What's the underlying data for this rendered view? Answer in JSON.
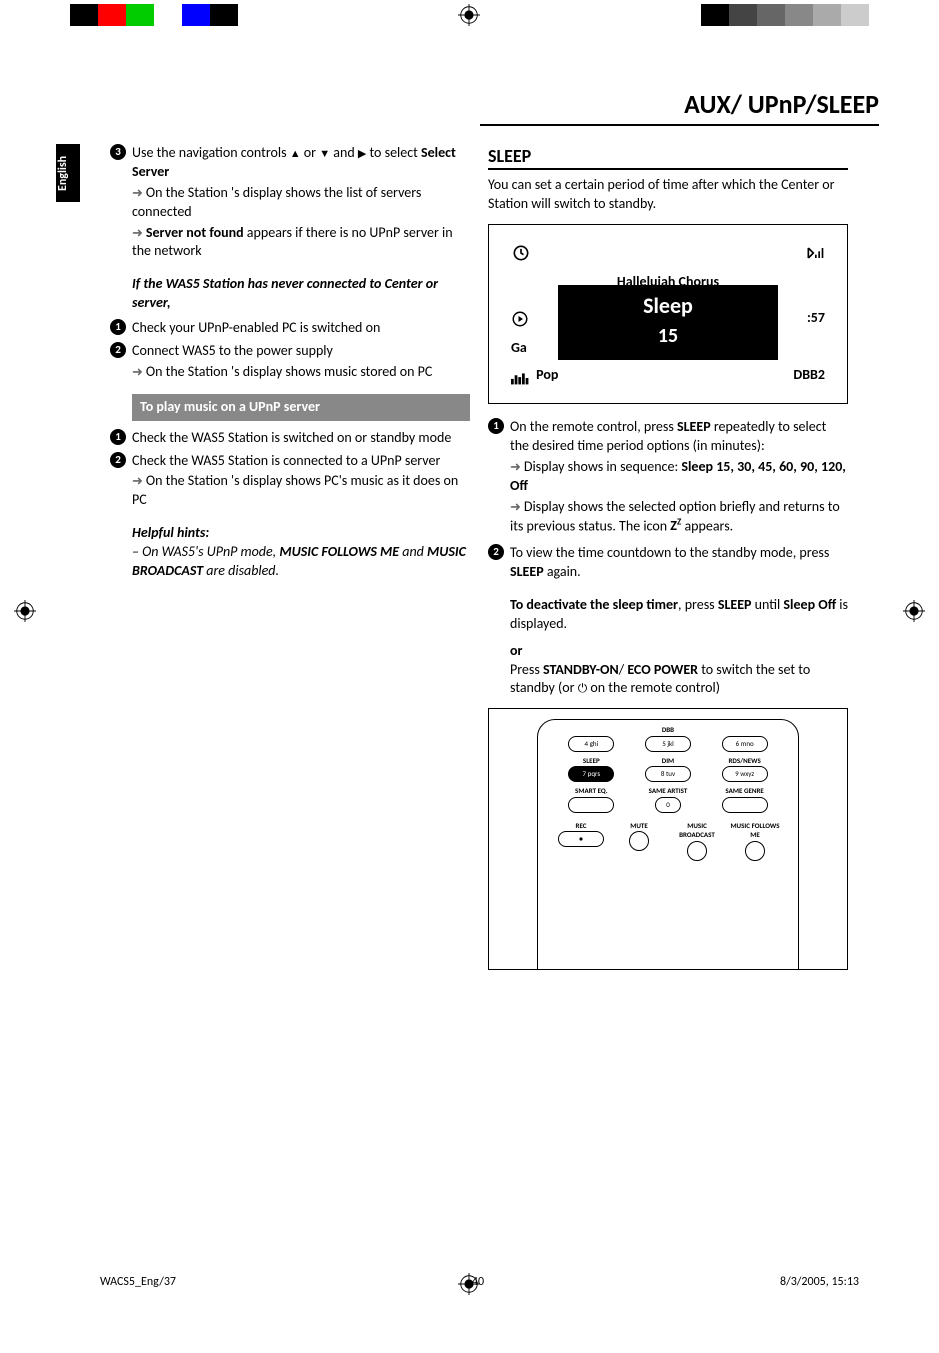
{
  "lang_tab": "English",
  "header": "AUX/ UPnP/SLEEP",
  "left": {
    "step3_a": "Use the navigation controls ",
    "step3_b": " or ",
    "step3_c": " and ",
    "step3_d": " to select ",
    "step3_bold": "Select Server",
    "step3_sub1": "On the Station 's display shows the list of servers connected",
    "step3_sub2_bold": "Server not found",
    "step3_sub2_rest": " appears if there is no UPnP server in the network",
    "if_heading": "If the WAS5 Station has never connected to Center or server,",
    "if_step1": "Check your UPnP-enabled PC is switched on",
    "if_step2": "Connect  WAS5 to the power supply",
    "if_step2_sub": "On the Station 's display shows music stored on PC",
    "play_box": "To play music on a UPnP server",
    "play_step1": "Check the WAS5 Station is switched on or standby mode",
    "play_step2": "Check the WAS5 Station is connected to a UPnP server",
    "play_step2_sub": "On the Station 's display shows PC's music as it does on PC",
    "hints_label": "Helpful hints:",
    "hints_body_a": "– On WAS5's UPnP mode, ",
    "hints_body_b": "MUSIC FOLLOWS ME",
    "hints_body_c": " and ",
    "hints_body_d": "MUSIC BROADCAST",
    "hints_body_e": " are disabled."
  },
  "right": {
    "sleep_h": "SLEEP",
    "sleep_intro": "You can set a certain period of time after which the Center or Station will switch to standby.",
    "lcd": {
      "song": "Halleluiah Chorus",
      "overlay_title": "Sleep",
      "overlay_value": "15",
      "time_suffix": ":57",
      "artist_initial": "Ga",
      "genre": "Pop",
      "dbb": "DBB2"
    },
    "s1_a": "On the remote control, press ",
    "s1_b": "SLEEP",
    "s1_c": " repeatedly to select the desired time period options (in minutes):",
    "s1_seq_a": "Display shows in sequence: ",
    "s1_seq_b": "Sleep 15,  30, 45, 60, 90, 120, Off",
    "s1_sel_a": "Display shows the selected option briefly and returns to its previous status. The icon ",
    "s1_sel_b": "Z",
    "s1_sel_c": " appears.",
    "s2_a": "To view the time countdown to the standby mode, press ",
    "s2_b": "SLEEP",
    "s2_c": " again.",
    "deact_a": "To deactivate the sleep timer",
    "deact_b": ", press ",
    "deact_c": "SLEEP",
    "deact_d": " until ",
    "deact_e": "Sleep Off",
    "deact_f": " is displayed.",
    "or": "or",
    "or_a": "Press ",
    "or_b": "STANDBY-ON",
    "or_c": "/ ",
    "or_d": "ECO POWER",
    "or_e": " to switch the set to standby (or ",
    "or_f": " on the remote control)",
    "remote": {
      "dbb": "DBB",
      "sleep": "SLEEP",
      "dim": "DIM",
      "rds": "RDS/NEWS",
      "smart_eq": "SMART EQ.",
      "same_artist": "SAME ARTIST",
      "same_genre": "SAME GENRE",
      "rec": "REC",
      "mute": "MUTE",
      "music_broadcast": "MUSIC BROADCAST",
      "music_follows": "MUSIC FOLLOWS ME",
      "k4": "4   ghi",
      "k5": "5   jkl",
      "k6": "6   mno",
      "k7": "7  pqrs",
      "k8": "8   tuv",
      "k9": "9  wxyz",
      "k0": "0"
    }
  },
  "footer": {
    "file": "WACS5_Eng/37",
    "page": "40",
    "date": "8/3/2005, 15:13"
  }
}
